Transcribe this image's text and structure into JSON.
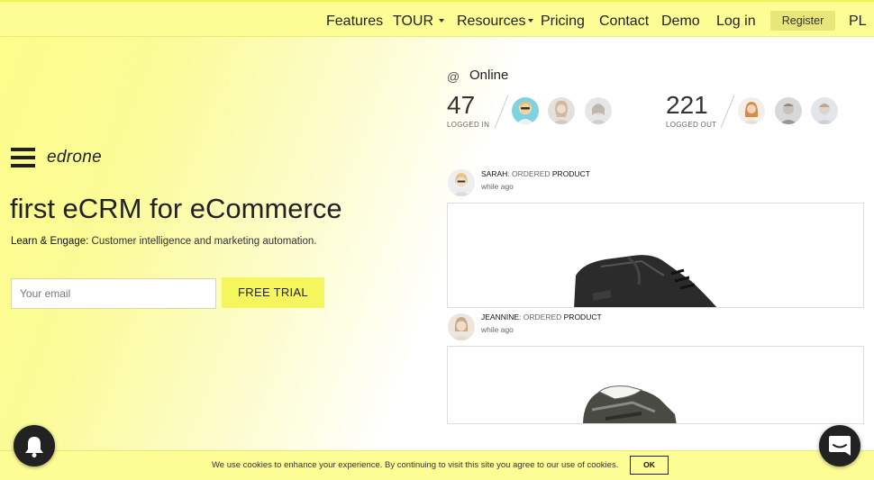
{
  "nav": {
    "features": "Features",
    "tour": "TOUR",
    "resources": "Resources",
    "pricing": "Pricing",
    "contact": "Contact",
    "demo": "Demo",
    "login": "Log in",
    "register": "Register",
    "language": "PL"
  },
  "hero": {
    "brand": "edrone",
    "headline": "first eCRM for eCommerce",
    "sub_bold": "Learn & Engage:",
    "sub_rest": " Customer intelligence and marketing automation.",
    "email_placeholder": "Your email",
    "trial_label": "FREE TRIAL"
  },
  "online": {
    "at": "@",
    "title": "Online",
    "logged_in_count": "47",
    "logged_in_label": "LOGGED IN",
    "logged_out_count": "221",
    "logged_out_label": "LOGGED OUT"
  },
  "feed": [
    {
      "name": "SARAH",
      "verb": ": ORDERED ",
      "object": "PRODUCT",
      "time": "while ago"
    },
    {
      "name": "JEANNINE",
      "verb": ": ORDERED ",
      "object": "PRODUCT",
      "time": "while ago"
    }
  ],
  "cookie": {
    "text": "We use cookies to enhance your experience. By continuing to visit this site you agree to our use of cookies.",
    "ok": "OK"
  },
  "icons": {
    "bell": "bell-icon",
    "chat": "chat-icon",
    "menu": "hamburger-icon"
  },
  "colors": {
    "accent_yellow": "#fdfd96",
    "button_yellow": "#f5f55e",
    "dark": "#222222"
  }
}
